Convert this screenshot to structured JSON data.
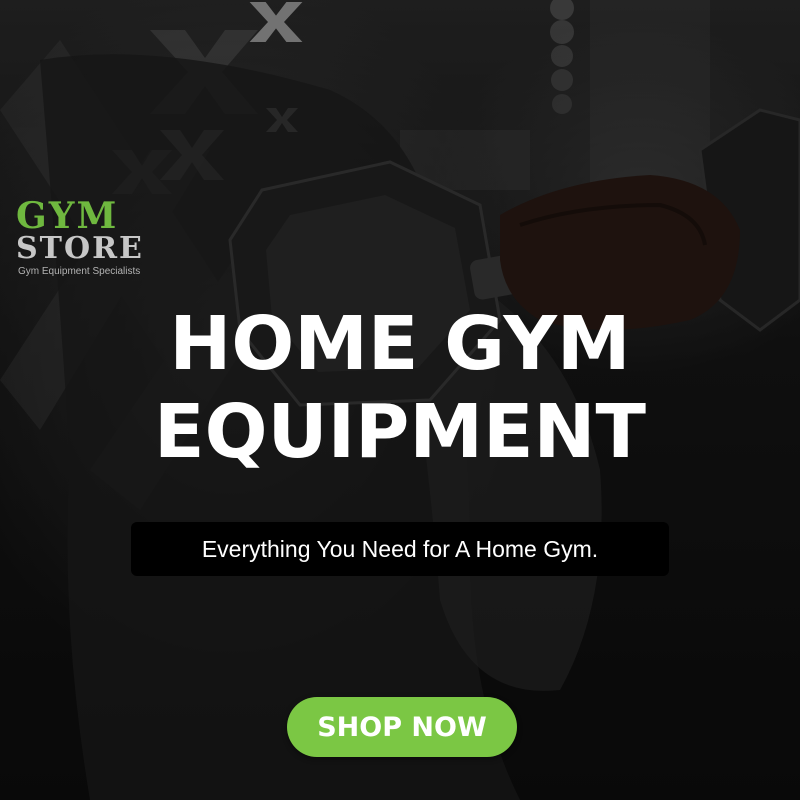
{
  "banner": {
    "logo": {
      "line1": "GYM",
      "line2": "STORE",
      "tagline": "Gym Equipment Specialists"
    },
    "headline": {
      "line1": "HOME GYM",
      "line2": "EQUIPMENT"
    },
    "tagline": "Everything You Need for A Home Gym.",
    "cta": {
      "label": "SHOP NOW"
    }
  },
  "colors": {
    "accent_green": "#7bc744",
    "logo_green": "#6fb83f",
    "text_white": "#ffffff",
    "tagline_bg": "#000000"
  },
  "icons": [
    "x-mark-icon",
    "dumbbell-icon"
  ]
}
